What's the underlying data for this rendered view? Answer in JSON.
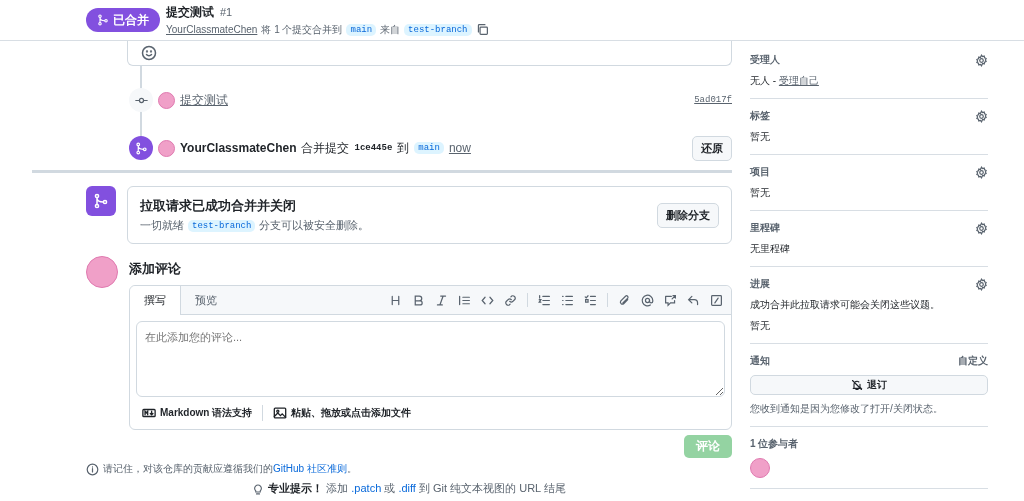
{
  "header": {
    "state": {
      "label": "已合并",
      "kind": "merged"
    },
    "title": "提交测试",
    "number": "#1",
    "author": "YourClassmateChen",
    "summary": "将 1 个提交合并到",
    "base": "main",
    "from": "来自",
    "head": "test-branch"
  },
  "timeline": [
    {
      "kind": "commit",
      "message": "提交测试",
      "sha": "5ad017f"
    },
    {
      "kind": "merge",
      "actor": "YourClassmateChen",
      "action": "合并提交",
      "sha": "1ce445e",
      "to": "到",
      "branch": "main",
      "time": "now",
      "button": "还原"
    }
  ],
  "merge_box": {
    "title": "拉取请求已成功合并并关闭",
    "text_before": "一切就绪",
    "branch": "test-branch",
    "text_after": "分支可以被安全删除。",
    "button": "删除分支"
  },
  "composer": {
    "heading": "添加评论",
    "tabs": [
      {
        "label": "撰写",
        "selected": true
      },
      {
        "label": "预览",
        "selected": false
      }
    ],
    "placeholder": "在此添加您的评论...",
    "markdown": "Markdown 语法支持",
    "attach": "粘贴、拖放或点击添加文件",
    "submit": {
      "label": "评论",
      "disabled": true
    }
  },
  "guideline": {
    "text": "请记住，对该仓库的贡献应遵循我们的",
    "link": "GitHub 社区准则",
    "end": "。"
  },
  "protip": {
    "label": "专业提示！",
    "before": "添加",
    "link_1": ".patch",
    "middle": "或",
    "link_2": ".diff",
    "after": "到 Git 纯文本视图的 URL 结尾"
  },
  "sidebar": [
    {
      "kind": "setting",
      "title": "受理人",
      "value": "无人 - ",
      "link": "受理自己"
    },
    {
      "kind": "setting",
      "title": "标签",
      "value": "暂无"
    },
    {
      "kind": "setting",
      "title": "项目",
      "value": "暂无"
    },
    {
      "kind": "setting",
      "title": "里程碑",
      "value": "无里程碑"
    },
    {
      "kind": "setting",
      "title": "进展",
      "note": "成功合并此拉取请求可能会关闭这些议题。",
      "value": "暂无"
    },
    {
      "kind": "notifications",
      "title": "通知",
      "action": "自定义",
      "button": "退订",
      "note": "您收到通知是因为您修改了打开/关闭状态。"
    },
    {
      "kind": "participants",
      "title": "1 位参与者"
    }
  ]
}
